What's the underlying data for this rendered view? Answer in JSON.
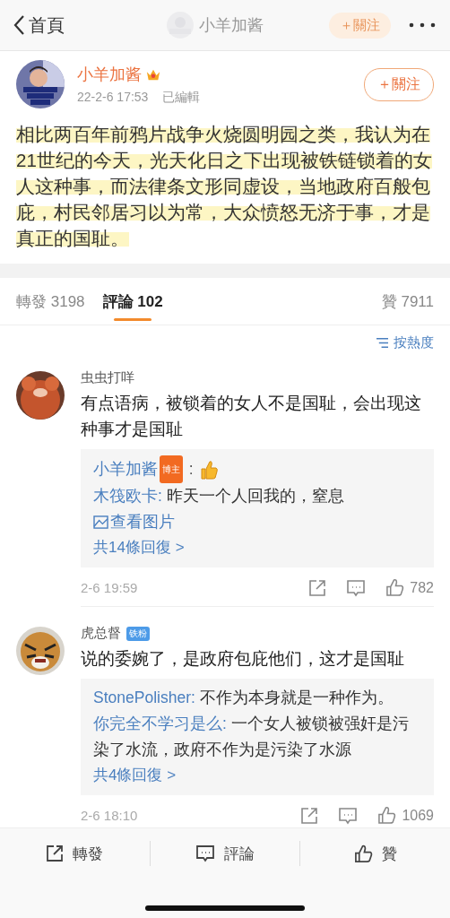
{
  "top_bar": {
    "back_label": "首頁",
    "title": "小羊加酱",
    "follow_label": "＋關注"
  },
  "post": {
    "author": "小羊加酱",
    "time": "22-2-6 17:53",
    "edited": "已編輯",
    "follow_label": "＋關注",
    "text": "相比两百年前鸦片战争火烧圆明园之类，我认为在21世纪的今天，光天化日之下出现被铁链锁着的女人这种事，而法律条文形同虚设，当地政府百般包庇，村民邻居习以为常，大众愤怒无济于事，才是真正的国耻。"
  },
  "tabs": [
    {
      "label": "轉發",
      "count": "3198",
      "selected": false
    },
    {
      "label": "評論",
      "count": "102",
      "selected": true
    },
    {
      "label": "贊",
      "count": "7911",
      "selected": false
    }
  ],
  "sort_label": "按熱度",
  "comments": [
    {
      "user": "虫虫打咩",
      "text": "有点语病，被锁着的女人不是国耻，会出现这种事才是国耻",
      "replies": [
        {
          "kind": "thumbs",
          "user": "小羊加酱",
          "badge": {
            "label": "博主",
            "color": "#f26a21"
          },
          "text": " :"
        },
        {
          "kind": "text",
          "user": "木筏欧卡:",
          "text": " 昨天一个人回我的，窒息 ",
          "link": "查看图片"
        }
      ],
      "more": "共14條回復 >",
      "time": "2-6 19:59",
      "likes": "782"
    },
    {
      "user": "虎总督",
      "badge": {
        "label": "铁粉",
        "color": "#4d9be8"
      },
      "text": "说的委婉了，是政府包庇他们，这才是国耻",
      "replies": [
        {
          "kind": "text",
          "user": "StonePolisher:",
          "text": " 不作为本身就是一种作为。"
        },
        {
          "kind": "text",
          "user": "你完全不学习是么:",
          "text": " 一个女人被锁被强奸是污染了水流，政府不作为是污染了水源"
        }
      ],
      "more": "共4條回復 >",
      "time": "2-6 18:10",
      "likes": "1069"
    }
  ],
  "actions": [
    {
      "kind": "repost",
      "label": "轉發"
    },
    {
      "kind": "comment",
      "label": "評論"
    },
    {
      "kind": "like",
      "label": "贊"
    }
  ]
}
